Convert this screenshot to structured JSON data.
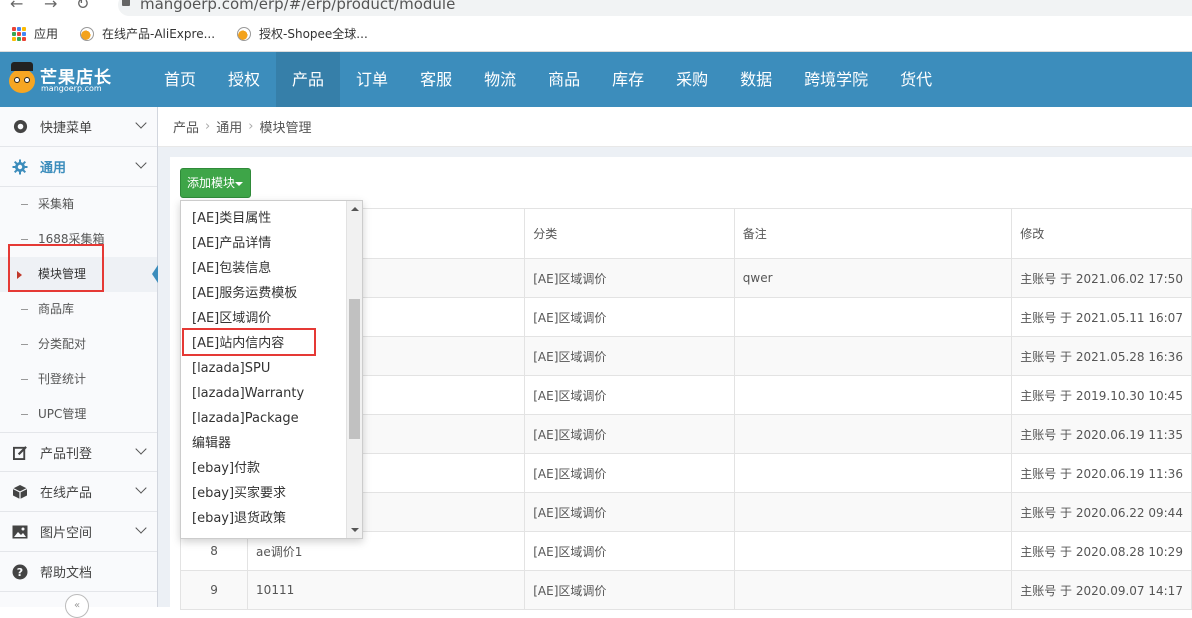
{
  "browser": {
    "url": "mangoerp.com/erp/#/erp/product/module",
    "bookmarks": [
      {
        "label": "应用",
        "icon": "apps-grid-icon"
      },
      {
        "label": "在线产品-AliExpre...",
        "icon": "mango-favicon-icon"
      },
      {
        "label": "授权-Shopee全球...",
        "icon": "mango-favicon-icon"
      }
    ]
  },
  "brand": {
    "name": "芒果店长",
    "domain": "mangoerp.com",
    "color": "#3c8dbc"
  },
  "nav": {
    "items": [
      "首页",
      "授权",
      "产品",
      "订单",
      "客服",
      "物流",
      "商品",
      "库存",
      "采购",
      "数据",
      "跨境学院",
      "货代"
    ],
    "active": "产品"
  },
  "sidebar": {
    "group_quick": "快捷菜单",
    "group_general": "通用",
    "sub": [
      "采集箱",
      "1688采集箱",
      "模块管理",
      "商品库",
      "分类配对",
      "刊登统计",
      "UPC管理"
    ],
    "active_sub": "模块管理",
    "groups_after": [
      {
        "label": "产品刊登",
        "icon": "edit-icon"
      },
      {
        "label": "在线产品",
        "icon": "box-icon"
      },
      {
        "label": "图片空间",
        "icon": "image-icon"
      },
      {
        "label": "帮助文档",
        "icon": "help-icon"
      }
    ]
  },
  "breadcrumb": [
    "产品",
    "通用",
    "模块管理"
  ],
  "toolbar": {
    "add_module": "添加模块"
  },
  "dropdown": {
    "items": [
      "[AE]类目属性",
      "[AE]产品详情",
      "[AE]包装信息",
      "[AE]服务运费模板",
      "[AE]区域调价",
      "[AE]站内信内容",
      "[lazada]SPU",
      "[lazada]Warranty",
      "[lazada]Package",
      "编辑器",
      "[ebay]付款",
      "[ebay]买家要求",
      "[ebay]退货政策"
    ],
    "highlighted": "[AE]站内信内容"
  },
  "table": {
    "headers": [
      "",
      "",
      "分类",
      "备注",
      "修改"
    ],
    "rows": [
      {
        "no": "",
        "name": "",
        "category": "[AE]区域调价",
        "note": "qwer",
        "modified": "主账号 于 2021.06.02 17:50"
      },
      {
        "no": "",
        "name": "",
        "category": "[AE]区域调价",
        "note": "",
        "modified": "主账号 于 2021.05.11 16:07"
      },
      {
        "no": "",
        "name": "",
        "category": "[AE]区域调价",
        "note": "",
        "modified": "主账号 于 2021.05.28 16:36"
      },
      {
        "no": "",
        "name": "",
        "category": "[AE]区域调价",
        "note": "",
        "modified": "主账号 于 2019.10.30 10:45"
      },
      {
        "no": "",
        "name": "",
        "category": "[AE]区域调价",
        "note": "",
        "modified": "主账号 于 2020.06.19 11:35"
      },
      {
        "no": "",
        "name": "",
        "category": "[AE]区域调价",
        "note": "",
        "modified": "主账号 于 2020.06.19 11:36"
      },
      {
        "no": "",
        "name": "",
        "category": "[AE]区域调价",
        "note": "",
        "modified": "主账号 于 2020.06.22 09:44"
      },
      {
        "no": "8",
        "name": "ae调价1",
        "category": "[AE]区域调价",
        "note": "",
        "modified": "主账号 于 2020.08.28 10:29"
      },
      {
        "no": "9",
        "name": "10111",
        "category": "[AE]区域调价",
        "note": "",
        "modified": "主账号 于 2020.09.07 14:17"
      }
    ]
  }
}
